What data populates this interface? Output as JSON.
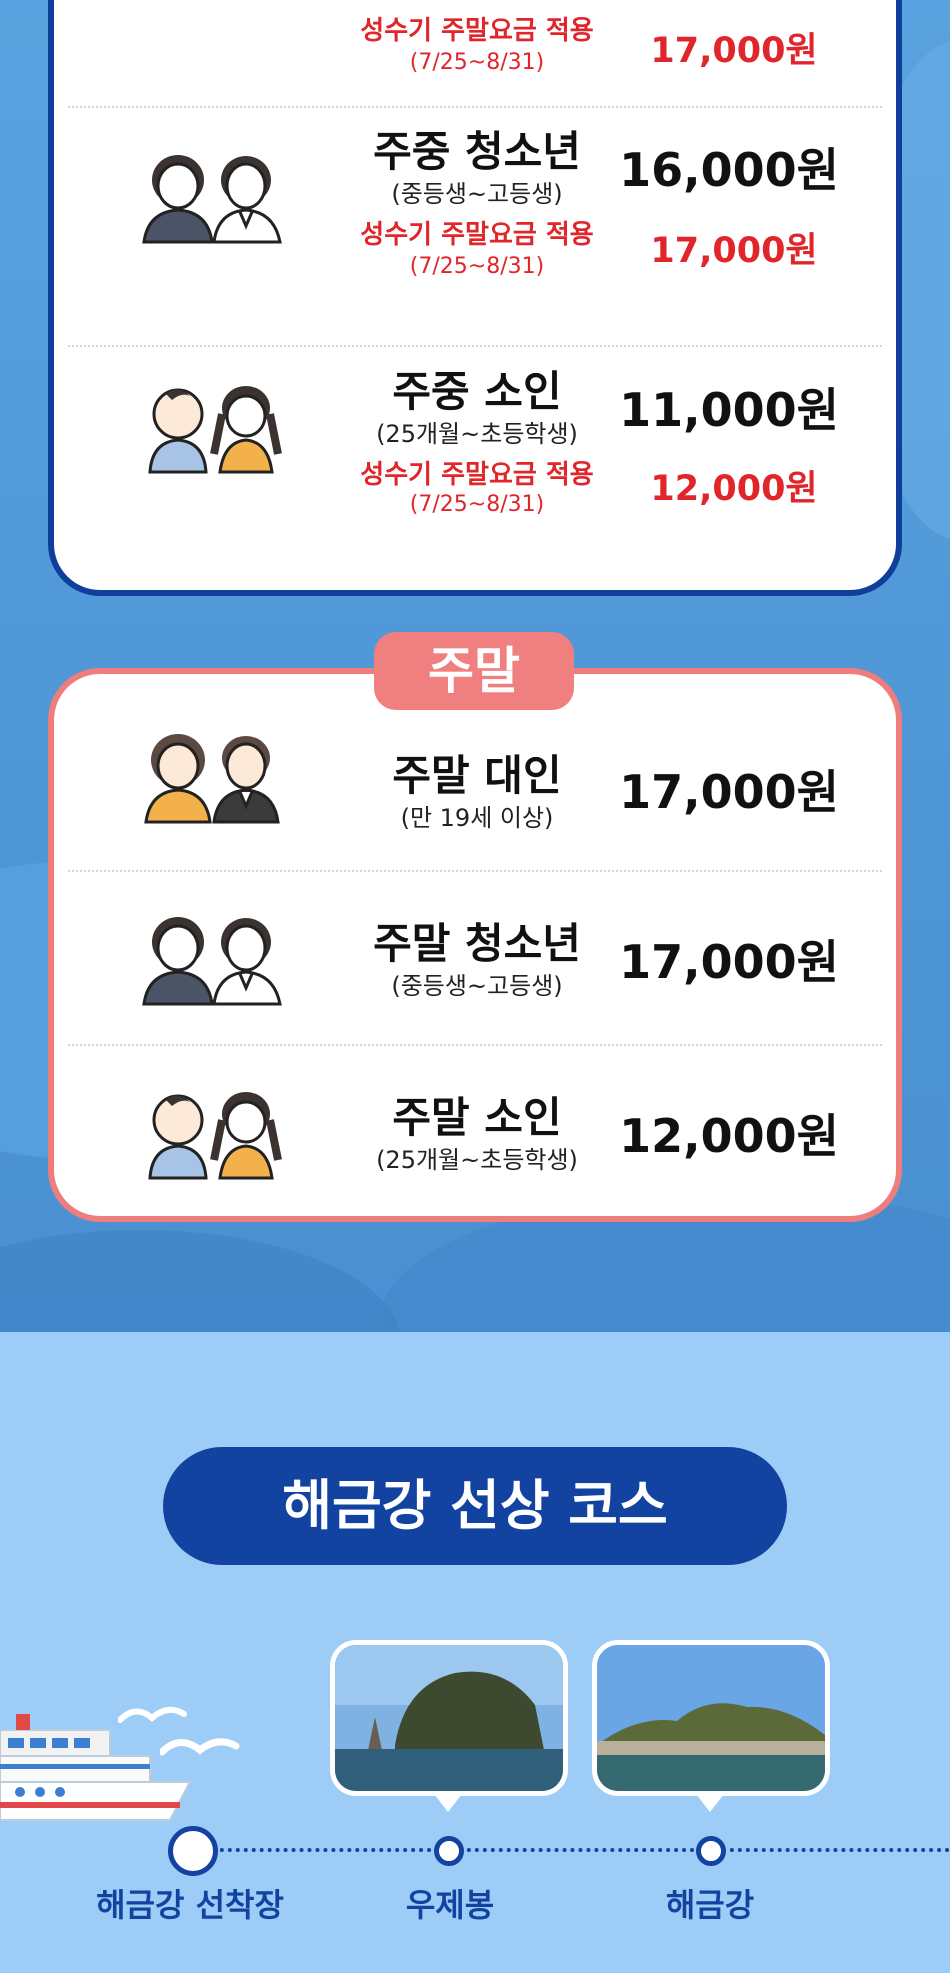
{
  "weekday": {
    "rows": [
      {
        "peak_label": "성수기 주말요금 적용",
        "peak_dates": "(7/25~8/31)",
        "peak_price": "17,000원"
      },
      {
        "title": "주중 청소년",
        "subtitle": "(중등생~고등생)",
        "price": "16,000원",
        "peak_label": "성수기 주말요금 적용",
        "peak_dates": "(7/25~8/31)",
        "peak_price": "17,000원",
        "icon": "teen-students-icon"
      },
      {
        "title": "주중 소인",
        "subtitle": "(25개월~초등학생)",
        "price": "11,000원",
        "peak_label": "성수기 주말요금 적용",
        "peak_dates": "(7/25~8/31)",
        "peak_price": "12,000원",
        "icon": "children-icon"
      }
    ]
  },
  "weekend": {
    "tag": "주말",
    "rows": [
      {
        "title": "주말 대인",
        "subtitle": "(만 19세 이상)",
        "price": "17,000원",
        "icon": "adults-icon"
      },
      {
        "title": "주말 청소년",
        "subtitle": "(중등생~고등생)",
        "price": "17,000원",
        "icon": "teen-students-icon"
      },
      {
        "title": "주말 소인",
        "subtitle": "(25개월~초등학생)",
        "price": "12,000원",
        "icon": "children-icon"
      }
    ]
  },
  "course": {
    "title": "해금강 선상 코스",
    "stops": [
      {
        "label": "해금강 선착장"
      },
      {
        "label": "우제봉"
      },
      {
        "label": "해금강"
      }
    ]
  },
  "colors": {
    "navy": "#1243a0",
    "peak_red": "#e0252b",
    "weekend_pink": "#f07f7f",
    "sky": "#9dccf6"
  }
}
